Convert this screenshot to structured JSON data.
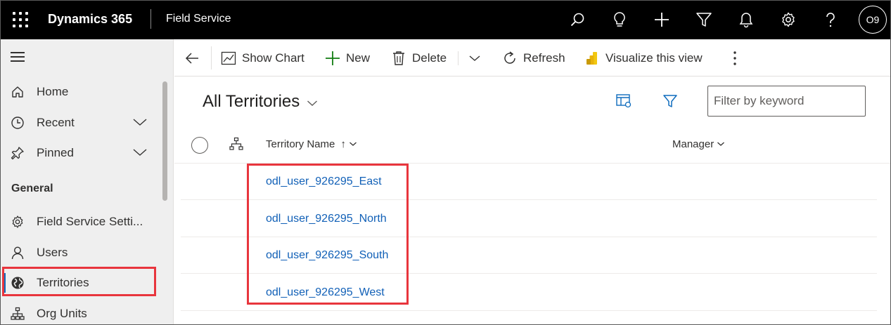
{
  "topbar": {
    "brand": "Dynamics 365",
    "app_name": "Field Service",
    "icons": [
      "search-icon",
      "lightbulb-icon",
      "plus-icon",
      "filter-icon",
      "bell-icon",
      "gear-icon",
      "help-icon"
    ],
    "avatar_initials": "O9"
  },
  "sidebar": {
    "home": "Home",
    "recent": "Recent",
    "pinned": "Pinned",
    "section_heading": "General",
    "items": [
      {
        "label": "Field Service Setti...",
        "icon": "gear-icon"
      },
      {
        "label": "Users",
        "icon": "person-icon"
      },
      {
        "label": "Territories",
        "icon": "globe-icon"
      },
      {
        "label": "Org Units",
        "icon": "org-chart-icon"
      }
    ],
    "active_item": "Territories"
  },
  "commandbar": {
    "show_chart": "Show Chart",
    "new": "New",
    "delete": "Delete",
    "refresh": "Refresh",
    "visualize": "Visualize this view"
  },
  "view": {
    "title": "All Territories",
    "filter_placeholder": "Filter by keyword",
    "columns": {
      "territory_name": "Territory Name",
      "manager": "Manager",
      "sort_indicator": "↑"
    },
    "rows": [
      {
        "name": "odl_user_926295_East",
        "manager": ""
      },
      {
        "name": "odl_user_926295_North",
        "manager": ""
      },
      {
        "name": "odl_user_926295_South",
        "manager": ""
      },
      {
        "name": "odl_user_926295_West",
        "manager": ""
      }
    ]
  },
  "colors": {
    "topbar_bg": "#000000",
    "sidebar_bg": "#efefef",
    "link": "#1160b7",
    "highlight": "#e8353d",
    "new_icon": "#107c10",
    "visualize_icon": "#f2c811"
  }
}
